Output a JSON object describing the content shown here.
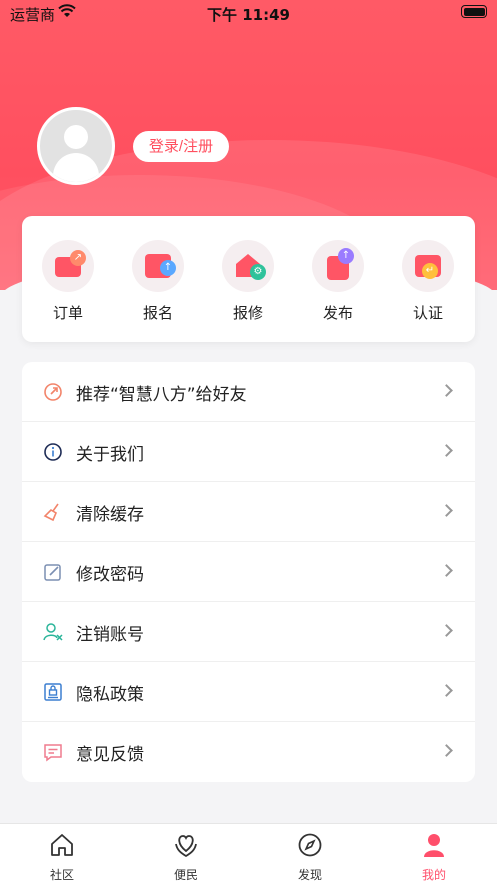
{
  "status_bar": {
    "carrier": "运营商",
    "time": "下午 11:49"
  },
  "profile": {
    "login_label": "登录/注册"
  },
  "quick_actions": [
    {
      "label": "订单",
      "icon": "order-icon"
    },
    {
      "label": "报名",
      "icon": "signup-icon"
    },
    {
      "label": "报修",
      "icon": "repair-icon"
    },
    {
      "label": "发布",
      "icon": "publish-icon"
    },
    {
      "label": "认证",
      "icon": "certify-icon"
    }
  ],
  "menu": [
    {
      "label": "推荐“智慧八方”给好友",
      "icon": "share-icon",
      "color": "#f2846a"
    },
    {
      "label": "关于我们",
      "icon": "info-icon",
      "color": "#1d2b55"
    },
    {
      "label": "清除缓存",
      "icon": "broom-icon",
      "color": "#f2846a"
    },
    {
      "label": "修改密码",
      "icon": "edit-icon",
      "color": "#7b8fb2"
    },
    {
      "label": "注销账号",
      "icon": "user-remove-icon",
      "color": "#2bb59a"
    },
    {
      "label": "隐私政策",
      "icon": "privacy-lock-icon",
      "color": "#3c7fd1"
    },
    {
      "label": "意见反馈",
      "icon": "feedback-icon",
      "color": "#ef7b8e"
    }
  ],
  "tabs": [
    {
      "label": "社区",
      "icon": "home-icon"
    },
    {
      "label": "便民",
      "icon": "heart-hands-icon"
    },
    {
      "label": "发现",
      "icon": "compass-icon"
    },
    {
      "label": "我的",
      "icon": "user-icon",
      "active": true
    }
  ],
  "colors": {
    "accent": "#ff4f5f",
    "active_tab": "#ff4f6b"
  }
}
